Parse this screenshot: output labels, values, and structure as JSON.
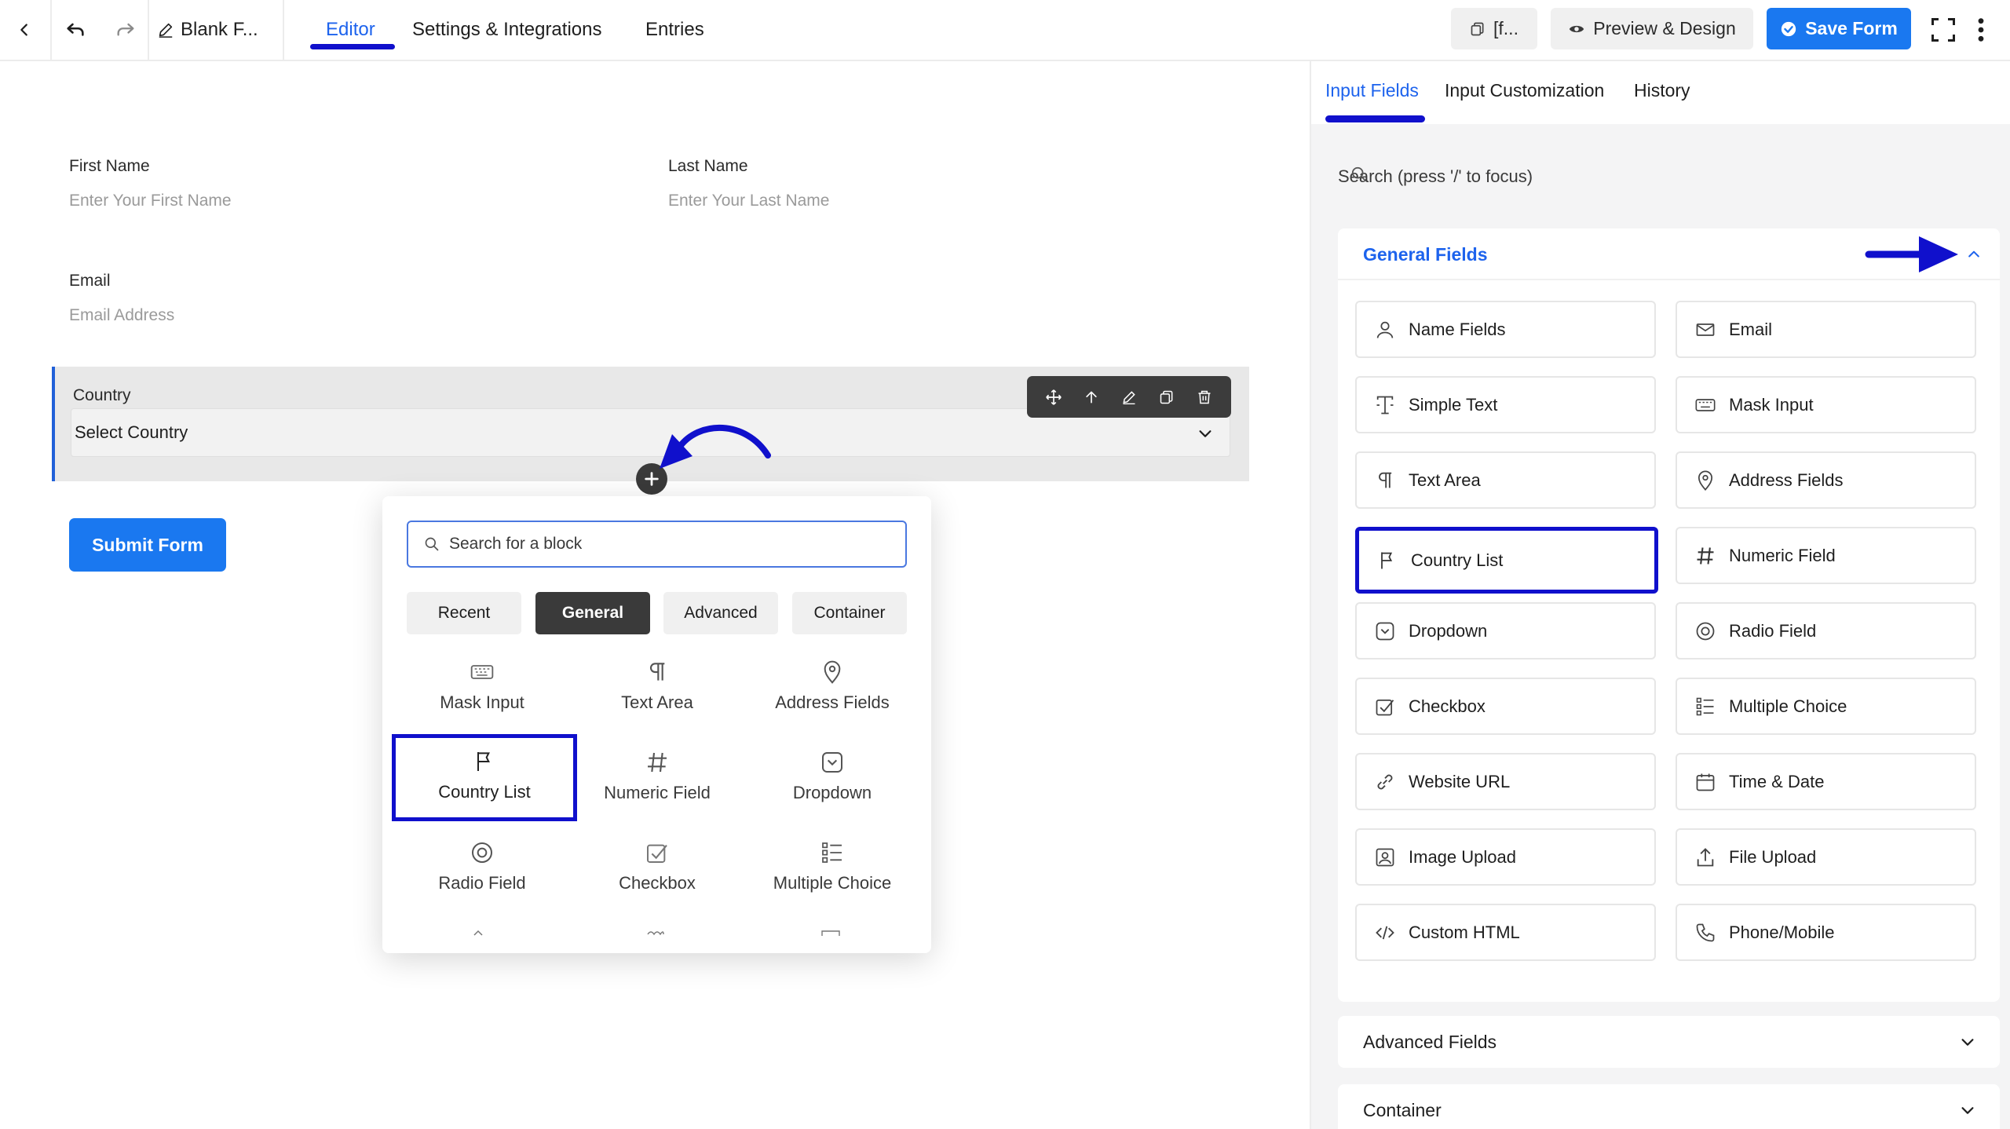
{
  "topbar": {
    "doc_title": "Blank F...",
    "tabs": [
      "Editor",
      "Settings & Integrations",
      "Entries"
    ],
    "shortcode_label": "[f...",
    "preview_label": "Preview & Design",
    "save_label": "Save Form"
  },
  "form": {
    "first_name_label": "First Name",
    "first_name_placeholder": "Enter Your First Name",
    "last_name_label": "Last Name",
    "last_name_placeholder": "Enter Your Last Name",
    "email_label": "Email",
    "email_placeholder": "Email Address",
    "country_label": "Country",
    "country_value": "Select Country",
    "submit_label": "Submit Form"
  },
  "inserter": {
    "search_placeholder": "Search for a block",
    "tabs": [
      "Recent",
      "General",
      "Advanced",
      "Container"
    ],
    "active_tab": "General",
    "items": [
      {
        "label": "Mask Input",
        "icon": "keyboard-icon"
      },
      {
        "label": "Text Area",
        "icon": "paragraph-icon"
      },
      {
        "label": "Address Fields",
        "icon": "map-pin-icon"
      },
      {
        "label": "Country List",
        "icon": "flag-icon"
      },
      {
        "label": "Numeric Field",
        "icon": "hash-icon"
      },
      {
        "label": "Dropdown",
        "icon": "dropdown-icon"
      },
      {
        "label": "Radio Field",
        "icon": "radio-icon"
      },
      {
        "label": "Checkbox",
        "icon": "checkbox-icon"
      },
      {
        "label": "Multiple Choice",
        "icon": "list-icon"
      }
    ]
  },
  "panel": {
    "tabs": [
      "Input Fields",
      "Input Customization",
      "History"
    ],
    "search_placeholder": "Search (press '/' to focus)",
    "general_title": "General Fields",
    "fields": [
      {
        "label": "Name Fields",
        "icon": "user-icon"
      },
      {
        "label": "Email",
        "icon": "mail-icon"
      },
      {
        "label": "Simple Text",
        "icon": "text-icon"
      },
      {
        "label": "Mask Input",
        "icon": "keyboard-icon"
      },
      {
        "label": "Text Area",
        "icon": "paragraph-icon"
      },
      {
        "label": "Address Fields",
        "icon": "map-pin-icon"
      },
      {
        "label": "Country List",
        "icon": "flag-icon"
      },
      {
        "label": "Numeric Field",
        "icon": "hash-icon"
      },
      {
        "label": "Dropdown",
        "icon": "dropdown-icon"
      },
      {
        "label": "Radio Field",
        "icon": "radio-icon"
      },
      {
        "label": "Checkbox",
        "icon": "checkbox-icon"
      },
      {
        "label": "Multiple Choice",
        "icon": "list-icon"
      },
      {
        "label": "Website URL",
        "icon": "link-icon"
      },
      {
        "label": "Time & Date",
        "icon": "calendar-icon"
      },
      {
        "label": "Image Upload",
        "icon": "image-icon"
      },
      {
        "label": "File Upload",
        "icon": "upload-icon"
      },
      {
        "label": "Custom HTML",
        "icon": "code-icon"
      },
      {
        "label": "Phone/Mobile",
        "icon": "phone-icon"
      }
    ],
    "advanced_title": "Advanced Fields",
    "container_title": "Container"
  },
  "colors": {
    "accent_blue": "#1a78f0",
    "active_text": "#1d63ed",
    "annotation": "#1010cc"
  }
}
